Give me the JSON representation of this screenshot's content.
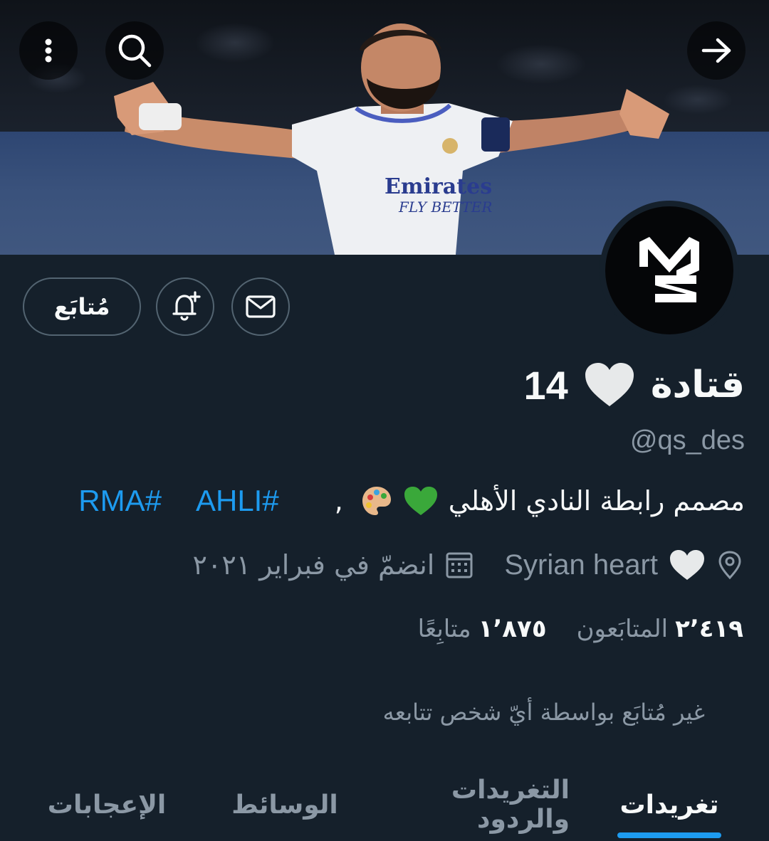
{
  "header": {
    "more_icon": "more-vertical-icon",
    "search_icon": "search-icon",
    "back_icon": "arrow-right-icon"
  },
  "profile": {
    "name": "قتادة",
    "name_suffix": "14",
    "handle": "@qs_des",
    "bio_text": "مصمم رابطة النادي الأهلي",
    "bio_separator": ",",
    "hashtags": [
      "#AHLI",
      "#RMA"
    ],
    "location": "Syrian heart",
    "joined": "انضمّ في فبراير ٢٠٢١",
    "followers_count": "٢٬٤١٩",
    "followers_label": "المتابَعون",
    "following_count": "١٬٨٧٥",
    "following_label": "متابِعًا",
    "not_followed_text": "غير مُتابَع بواسطة أيّ شخص تتابعه"
  },
  "actions": {
    "follow_label": "مُتابَع",
    "notify_icon": "bell-plus-icon",
    "message_icon": "envelope-icon"
  },
  "tabs": [
    {
      "label": "تغريدات",
      "active": true
    },
    {
      "label": "التغريدات والردود",
      "active": false
    },
    {
      "label": "الوسائط",
      "active": false
    },
    {
      "label": "الإعجابات",
      "active": false
    }
  ],
  "colors": {
    "background": "#15202b",
    "accent": "#1d9bf0",
    "secondary_text": "#8b98a5",
    "bio_heart": "#3aa83a"
  }
}
